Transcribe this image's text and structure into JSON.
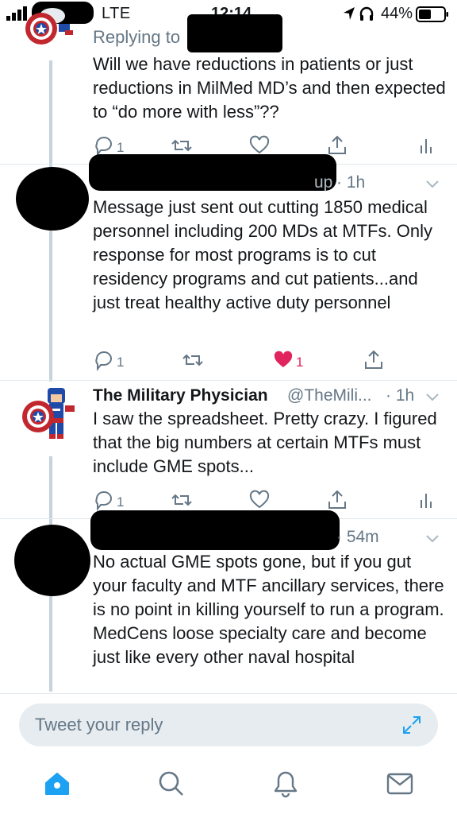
{
  "status_bar": {
    "network": "LTE",
    "time": "12:14",
    "battery_percent": "44%"
  },
  "tweets": [
    {
      "replying_to": "Replying to",
      "text": "Will we have reductions in patients or just reductions in MilMed MD’s and then expected to “do more with less”??",
      "replies": "1",
      "retweets": "",
      "likes": "",
      "liked": false
    },
    {
      "time": "· 1h",
      "text": "Message just sent out cutting 1850 medical personnel including 200 MDs at MTFs. Only response for most programs is to cut residency programs and cut patients...and just treat healthy active duty personnel",
      "replies": "1",
      "retweets": "",
      "likes": "1",
      "liked": true
    },
    {
      "name": "The Military Physician",
      "handle": "@TheMili...",
      "time": "· 1h",
      "text": "I saw the spreadsheet.  Pretty crazy.  I figured that the big numbers at certain MTFs must include GME spots...",
      "replies": "1",
      "retweets": "",
      "likes": "",
      "liked": false
    },
    {
      "time": "· 54m",
      "text": "No actual GME spots gone, but if you gut your faculty and MTF ancillary services, there is no point in killing yourself to run a program. MedCens loose specialty care and become just like every other naval hospital"
    }
  ],
  "composer": {
    "placeholder": "Tweet your reply"
  },
  "colors": {
    "accent": "#1da1f2",
    "like": "#e0245e",
    "muted": "#657786"
  },
  "icons": {
    "tabbar": [
      "home-icon",
      "search-icon",
      "notifications-icon",
      "messages-icon"
    ],
    "actions": [
      "reply-icon",
      "retweet-icon",
      "like-icon",
      "share-icon",
      "analytics-icon"
    ]
  }
}
